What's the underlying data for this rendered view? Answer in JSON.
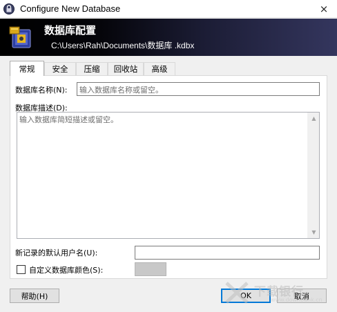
{
  "window": {
    "title": "Configure New Database",
    "close_icon": "×"
  },
  "banner": {
    "title": "数据库配置",
    "path": "C:\\Users\\Rah\\Documents\\数据库 .kdbx"
  },
  "tabs": [
    {
      "label": "常规",
      "active": true
    },
    {
      "label": "安全",
      "active": false
    },
    {
      "label": "压缩",
      "active": false
    },
    {
      "label": "回收站",
      "active": false
    },
    {
      "label": "高级",
      "active": false
    }
  ],
  "general": {
    "name_label": "数据库名称(N):",
    "name_placeholder": "输入数据库名称或留空。",
    "name_value": "",
    "description_label": "数据库描述(D):",
    "description_placeholder": "输入数据库简短描述或留空。",
    "default_user_label": "新记录的默认用户名(U):",
    "default_user_value": "",
    "custom_color_label": "自定义数据库颜色(S):",
    "custom_color_checked": false,
    "swatch_color": "#c8c8c8"
  },
  "buttons": {
    "help": "帮助(H)",
    "ok": "OK",
    "cancel": "取消"
  },
  "watermark": {
    "text": "下载银行",
    "sub": "www.downbank.cn"
  },
  "colors": {
    "accent": "#0078d7",
    "banner_dark": "#000000",
    "banner_light": "#34365e"
  }
}
